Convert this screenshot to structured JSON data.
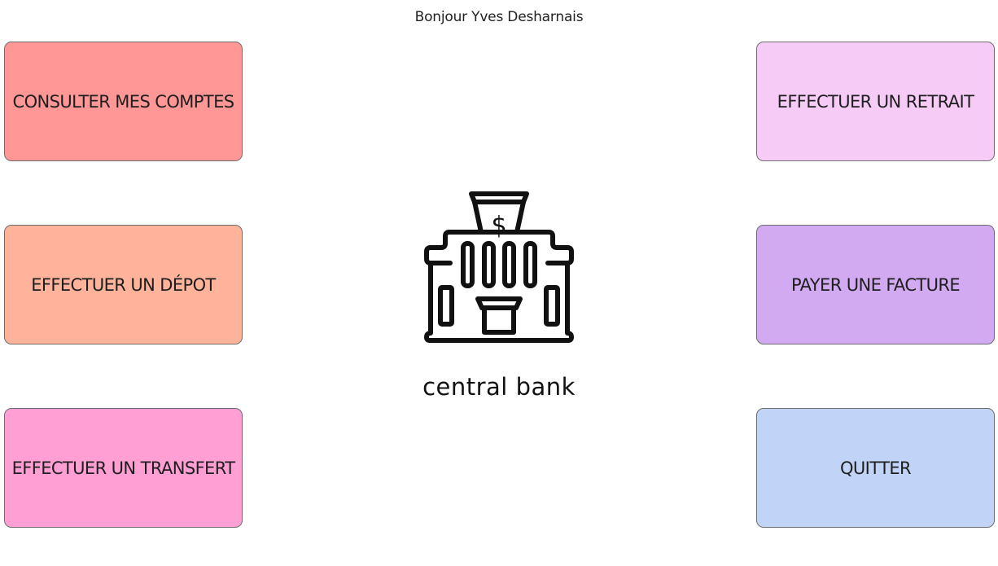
{
  "header": {
    "greeting": "Bonjour Yves Desharnais"
  },
  "menu": {
    "consult_accounts": {
      "label": "CONSULTER MES COMPTES",
      "color": "#ff9797"
    },
    "deposit": {
      "label": "EFFECTUER UN DÉPOT",
      "color": "#ffb39b"
    },
    "transfer": {
      "label": "EFFECTUER UN TRANSFERT",
      "color": "#ff9fd3"
    },
    "withdraw": {
      "label": "EFFECTUER UN RETRAIT",
      "color": "#f6ccf7"
    },
    "pay_bill": {
      "label": "PAYER UNE FACTURE",
      "color": "#d1aaf2"
    },
    "quit": {
      "label": "QUITTER",
      "color": "#c1d4f7"
    }
  },
  "brand": {
    "logo_icon": "bank-building-icon",
    "name": "central bank"
  }
}
